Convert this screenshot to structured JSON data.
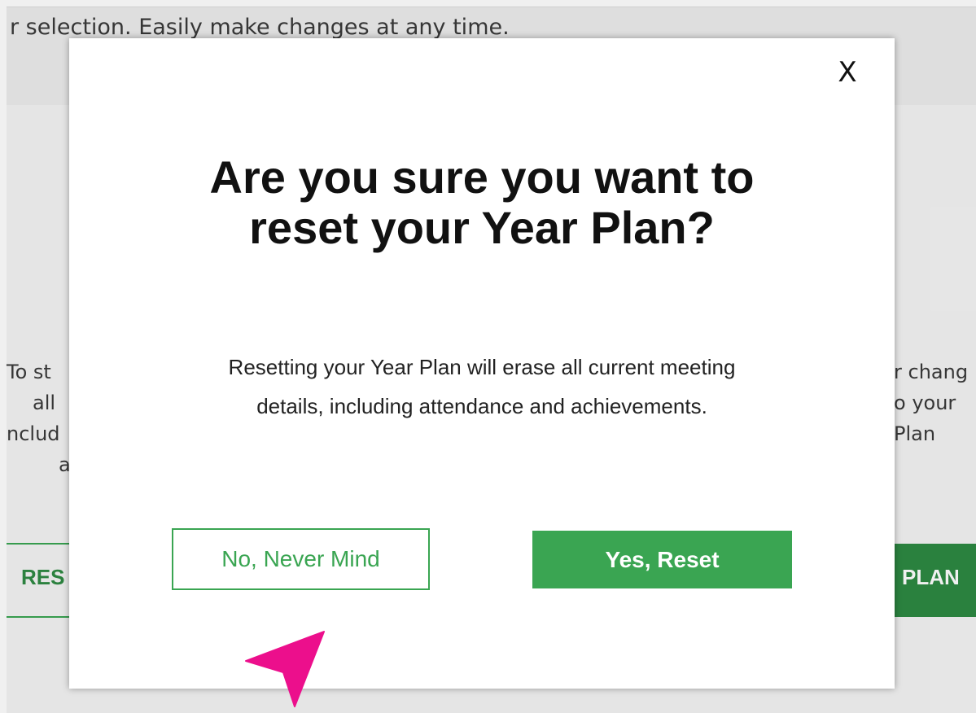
{
  "background": {
    "intro_text": "r selection. Easily make changes at any time.",
    "left_column_lines": [
      "To st",
      "all",
      "nclud",
      "a"
    ],
    "right_column_lines": [
      "r chang",
      "o your",
      "Plan"
    ],
    "reset_button_label": "RES",
    "new_plan_button_label": "PLAN"
  },
  "modal": {
    "close_label": "X",
    "title": "Are you sure you want to reset your Year Plan?",
    "body": "Resetting your Year Plan will erase all current meeting details, including attendance and achievements.",
    "cancel_label": "No, Never Mind",
    "confirm_label": "Yes, Reset"
  },
  "colors": {
    "accent_green": "#3aa552",
    "cursor_pink": "#ec0f8c"
  },
  "icons": {
    "cursor": "pointer-arrow-icon"
  }
}
